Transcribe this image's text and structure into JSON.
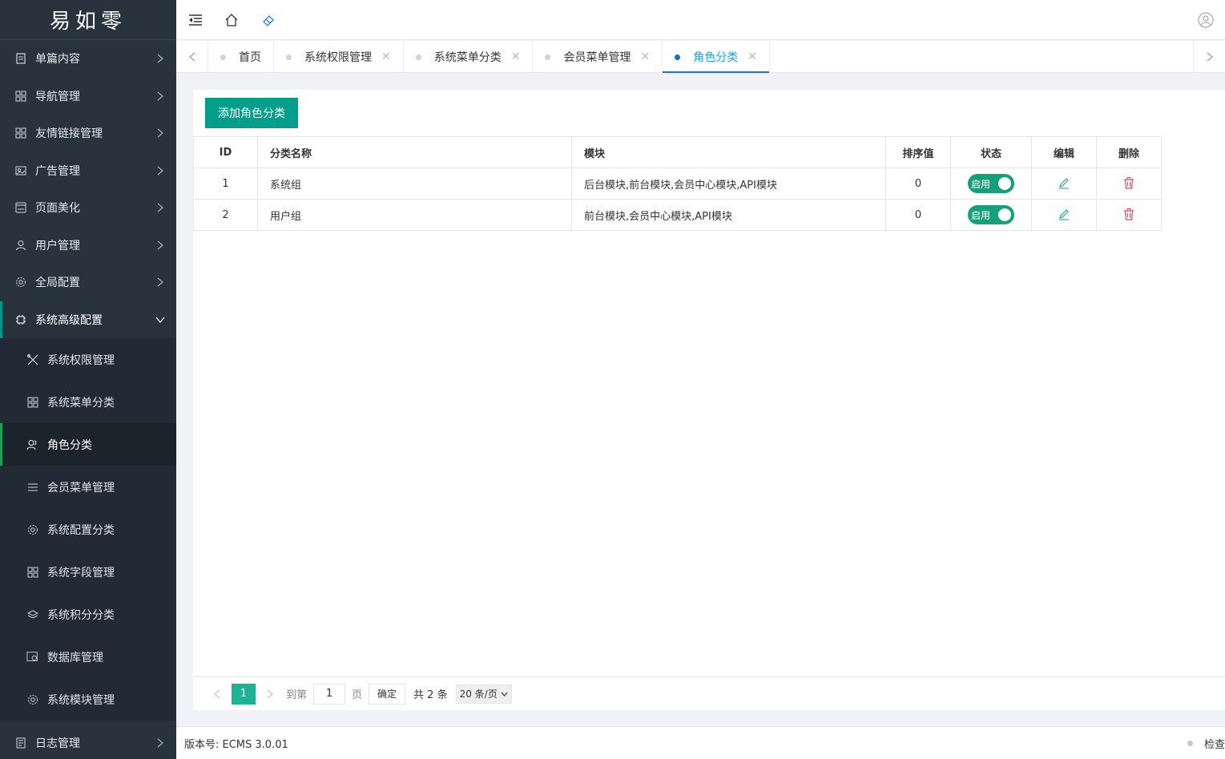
{
  "logo": {
    "text": "易如零"
  },
  "sidebar": {
    "items": [
      {
        "label": "单篇内容",
        "icon": "document-icon"
      },
      {
        "label": "导航管理",
        "icon": "grid-icon"
      },
      {
        "label": "友情链接管理",
        "icon": "grid-icon"
      },
      {
        "label": "广告管理",
        "icon": "image-icon"
      },
      {
        "label": "页面美化",
        "icon": "window-icon"
      },
      {
        "label": "用户管理",
        "icon": "user-icon"
      },
      {
        "label": "全局配置",
        "icon": "gear-icon"
      },
      {
        "label": "系统高级配置",
        "icon": "chip-icon",
        "open": true
      }
    ],
    "subitems": [
      {
        "label": "系统权限管理",
        "icon": "tools-icon"
      },
      {
        "label": "系统菜单分类",
        "icon": "grid-icon"
      },
      {
        "label": "角色分类",
        "icon": "users-icon",
        "active": true
      },
      {
        "label": "会员菜单管理",
        "icon": "list-icon"
      },
      {
        "label": "系统配置分类",
        "icon": "gear-icon"
      },
      {
        "label": "系统字段管理",
        "icon": "grid-icon"
      },
      {
        "label": "系统积分分类",
        "icon": "stack-icon"
      },
      {
        "label": "数据库管理",
        "icon": "database-icon"
      },
      {
        "label": "系统模块管理",
        "icon": "gear-icon"
      }
    ],
    "after": [
      {
        "label": "日志管理",
        "icon": "log-icon"
      }
    ]
  },
  "header": {
    "icons": [
      "menu-collapse-icon",
      "home-icon",
      "eraser-icon",
      "user-avatar-icon"
    ]
  },
  "tabs": [
    {
      "label": "首页",
      "closable": false
    },
    {
      "label": "系统权限管理",
      "closable": true
    },
    {
      "label": "系统菜单分类",
      "closable": true
    },
    {
      "label": "会员菜单管理",
      "closable": true
    },
    {
      "label": "角色分类",
      "closable": true,
      "active": true
    }
  ],
  "toolbar": {
    "add_label": "添加角色分类"
  },
  "table": {
    "columns": [
      "ID",
      "分类名称",
      "模块",
      "排序值",
      "状态",
      "编辑",
      "删除"
    ],
    "rows": [
      {
        "id": "1",
        "name": "系统组",
        "modules": "后台模块,前台模块,会员中心模块,API模块",
        "sort": "0",
        "status": "启用"
      },
      {
        "id": "2",
        "name": "用户组",
        "modules": "前台模块,会员中心模块,API模块",
        "sort": "0",
        "status": "启用"
      }
    ]
  },
  "pager": {
    "current": "1",
    "goto_label": "到第",
    "goto_value": "1",
    "page_label": "页",
    "confirm_label": "确定",
    "total_label": "共 2 条",
    "page_size": "20 条/页"
  },
  "footer": {
    "version": "版本号: ECMS 3.0.01",
    "check": "检查"
  },
  "colors": {
    "sidebar_bg": "#28333e",
    "accent": "#009f8b",
    "active_tab": "#1e9fff",
    "delete_icon": "#e0435c"
  }
}
